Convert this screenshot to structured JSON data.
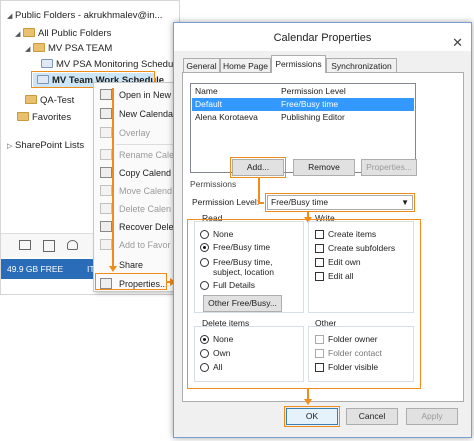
{
  "outlook": {
    "header": "Public Folders - akrukhmalev@in...",
    "tree": [
      "All Public Folders",
      "MV PSA TEAM",
      "MV PSA Monitoring Schedule",
      "MV Team Work Schedule",
      "QA-Test",
      "Favorites",
      "SharePoint Lists"
    ],
    "status_text": "49.9 GB FREE",
    "status_extra": "IT"
  },
  "context_menu": {
    "items": [
      "Open in New",
      "New Calenda",
      "Overlay",
      "Rename Cale",
      "Copy Calend",
      "Move Calend",
      "Delete Calen",
      "Recover Dele",
      "Add to Favor",
      "Share",
      "Properties..."
    ]
  },
  "dialog": {
    "title": "Calendar Properties",
    "close": "✕",
    "tabs": [
      "General",
      "Home Page",
      "Permissions",
      "Synchronization"
    ],
    "list_headers": [
      "Name",
      "Permission Level"
    ],
    "list_rows": [
      {
        "name": "Default",
        "level": "Free/Busy time"
      },
      {
        "name": "Alena Korotaeva",
        "level": "Publishing Editor"
      }
    ],
    "add_button": "Add...",
    "remove_button": "Remove",
    "properties_button": "Properties...",
    "permissions_label": "Permissions",
    "permission_level_label": "Permission Level:",
    "permission_level_value": "Free/Busy time",
    "read_label": "Read",
    "read_options": [
      "None",
      "Free/Busy time",
      "Free/Busy time, subject, location",
      "Full Details"
    ],
    "read_selected": 1,
    "other_freebusy_button": "Other Free/Busy...",
    "write_label": "Write",
    "write_options": [
      "Create items",
      "Create subfolders",
      "Edit own",
      "Edit all"
    ],
    "delete_label": "Delete items",
    "delete_options": [
      "None",
      "Own",
      "All"
    ],
    "delete_selected": 0,
    "other_label": "Other",
    "other_options": [
      "Folder owner",
      "Folder contact",
      "Folder visible"
    ],
    "ok_button": "OK",
    "cancel_button": "Cancel",
    "apply_button": "Apply",
    "highlight_color": "#f08c1a",
    "selection_color": "#3399ff"
  }
}
